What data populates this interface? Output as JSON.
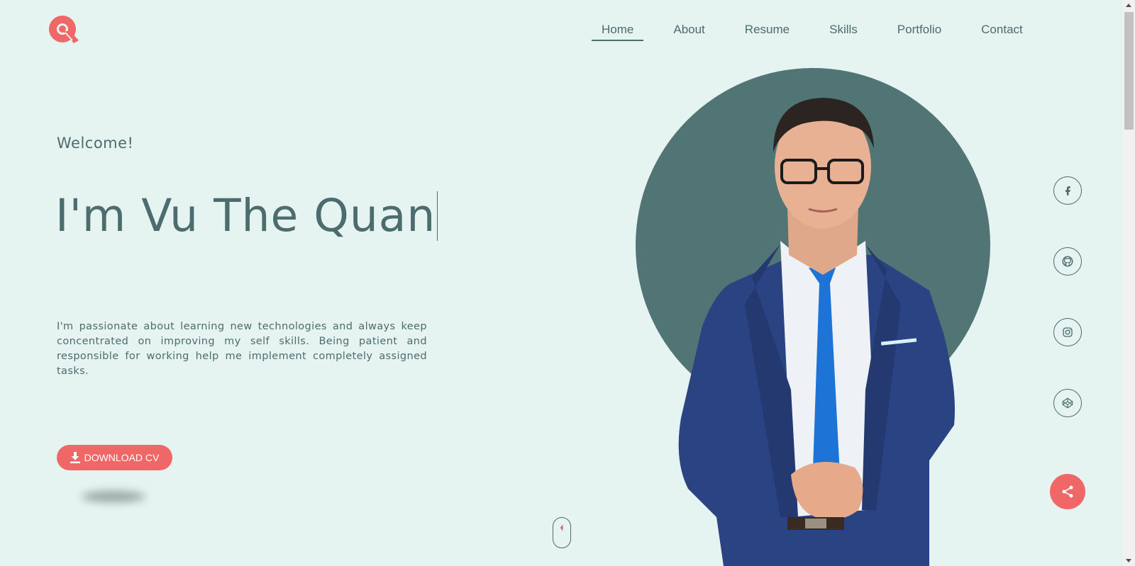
{
  "brand": {
    "logo": "q-logo-icon",
    "accent_color": "#f06767",
    "text_color": "#4d6c6d",
    "background": "#e5f4f1"
  },
  "nav": {
    "items": [
      {
        "label": "Home",
        "active": true
      },
      {
        "label": "About"
      },
      {
        "label": "Resume"
      },
      {
        "label": "Skills"
      },
      {
        "label": "Portfolio"
      },
      {
        "label": "Contact"
      }
    ]
  },
  "hero": {
    "welcome": "Welcome!",
    "title": "I'm Vu The Quan",
    "intro": "I'm passionate about learning new technologies and always keep concentrated on improving my self skills. Being patient and responsible for working help me implement completely assigned tasks.",
    "download_label": "DOWNLOAD CV",
    "download_icon": "download-icon"
  },
  "portrait": {
    "circle_color": "#517474"
  },
  "social": [
    {
      "icon": "facebook-icon"
    },
    {
      "icon": "github-icon"
    },
    {
      "icon": "instagram-icon"
    },
    {
      "icon": "codepen-icon"
    }
  ],
  "share": {
    "icon": "share-icon"
  },
  "scroll_indicator": {
    "icon": "mouse-scroll-icon"
  }
}
